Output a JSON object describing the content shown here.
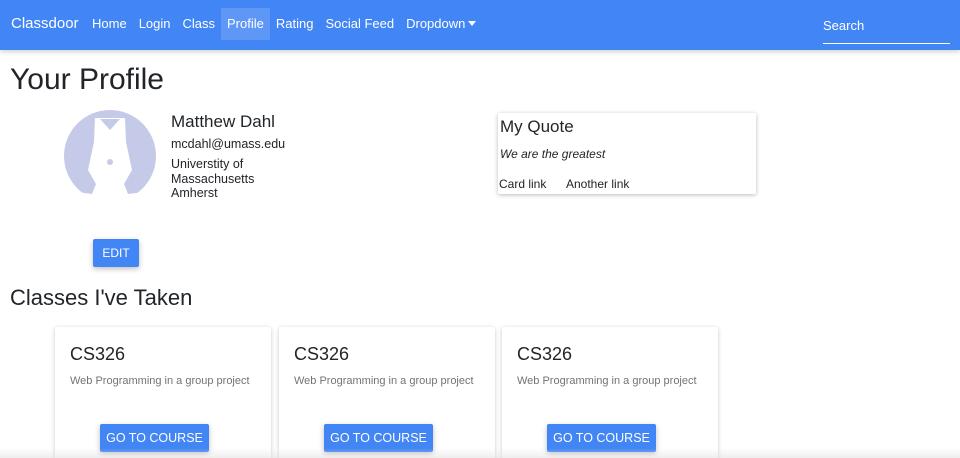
{
  "navbar": {
    "brand": "Classdoor",
    "links": [
      {
        "label": "Home"
      },
      {
        "label": "Login"
      },
      {
        "label": "Class"
      },
      {
        "label": "Profile",
        "active": true
      },
      {
        "label": "Rating"
      },
      {
        "label": "Social Feed"
      },
      {
        "label": "Dropdown",
        "dropdown": true
      }
    ],
    "search_placeholder": "Search",
    "color": "#4285f4"
  },
  "page": {
    "title": "Your Profile"
  },
  "profile": {
    "avatar_icon": "avatar-silhouette-icon",
    "name": "Matthew Dahl",
    "email": "mcdahl@umass.edu",
    "school": "Universtity of Massachusetts Amherst",
    "edit_label": "EDIT"
  },
  "quote_card": {
    "title": "My Quote",
    "text": "We are the greatest",
    "links": [
      "Card link",
      "Another link"
    ]
  },
  "classes": {
    "title": "Classes I've Taken",
    "courses": [
      {
        "code": "CS326",
        "description": "Web Programming in a group project",
        "button_label": "GO TO COURSE"
      },
      {
        "code": "CS326",
        "description": "Web Programming in a group project",
        "button_label": "GO TO COURSE"
      },
      {
        "code": "CS326",
        "description": "Web Programming in a group project",
        "button_label": "GO TO COURSE"
      }
    ]
  },
  "colors": {
    "accent": "#4285f4",
    "avatar": "#c5cae9"
  }
}
